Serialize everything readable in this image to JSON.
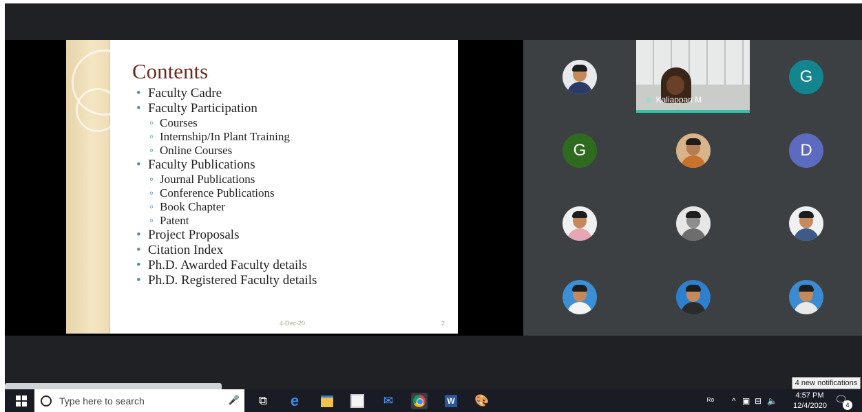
{
  "slide": {
    "title": "Contents",
    "items": [
      {
        "level": 1,
        "text": "Faculty Cadre"
      },
      {
        "level": 1,
        "text": "Faculty Participation"
      },
      {
        "level": 2,
        "text": "Courses"
      },
      {
        "level": 2,
        "text": "Internship/In Plant Training"
      },
      {
        "level": 2,
        "text": "Online Courses"
      },
      {
        "level": 1,
        "text": "Faculty Publications"
      },
      {
        "level": 2,
        "text": "Journal Publications"
      },
      {
        "level": 2,
        "text": "Conference Publications"
      },
      {
        "level": 2,
        "text": "Book Chapter"
      },
      {
        "level": 2,
        "text": "Patent"
      },
      {
        "level": 1,
        "text": "Project Proposals"
      },
      {
        "level": 1,
        "text": "Citation Index"
      },
      {
        "level": 1,
        "text": "Ph.D. Awarded Faculty details"
      },
      {
        "level": 1,
        "text": "Ph.D. Registered Faculty details"
      }
    ],
    "footer_date": "4-Dec-20",
    "page_number": "2"
  },
  "meeting": {
    "speaker_name": "Kaliappan M",
    "avatar_letters": {
      "g1": "G",
      "g2": "G",
      "d": "D"
    },
    "colors": {
      "teal": "#12858f",
      "green": "#2f6b1f",
      "indigo": "#5c6bc0",
      "speaking": "#2ec4a6"
    }
  },
  "taskbar": {
    "search_placeholder": "Type here to search",
    "time": "4:57 PM",
    "date": "12/4/2020",
    "notification_count": "4",
    "notification_tooltip": "4 new notifications",
    "apps": [
      "task-view",
      "edge",
      "file-explorer",
      "store",
      "mail",
      "chrome",
      "word",
      "paint"
    ]
  }
}
